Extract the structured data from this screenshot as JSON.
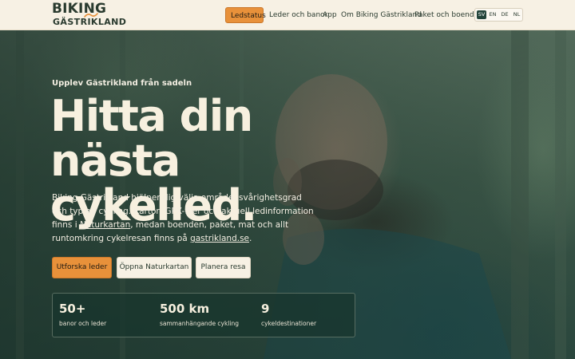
{
  "brand": {
    "logo_top": "BIKING",
    "logo_bottom": "GÄSTRIKLAND",
    "accent": "#e8913a",
    "dark": "#22443a"
  },
  "nav": {
    "items": [
      {
        "label": "Ledstatus",
        "active": true
      },
      {
        "label": "Leder och banor"
      },
      {
        "label": "App"
      },
      {
        "label": "Om Biking Gästrikland"
      },
      {
        "label": "Paket och boende"
      }
    ],
    "languages": [
      {
        "code": "SV",
        "active": true
      },
      {
        "code": "EN"
      },
      {
        "code": "DE"
      },
      {
        "code": "NL"
      }
    ]
  },
  "hero": {
    "eyebrow": "Upplev Gästrikland från sadeln",
    "headline_line1": "Hitta din nästa",
    "headline_line2": "cykelled.",
    "intro_before_link1": "Biking Gästrikland hjälper dig välja område, svårighetsgrad och typ av cykling. Kartor, GPX-filer och aktuell ledinformation finns i ",
    "intro_link1": "Naturkartan",
    "intro_between": ", medan boenden, paket, mat och allt runtomkring cykelresan finns på ",
    "intro_link2": "gastrikland.se",
    "intro_after": ".",
    "buttons": {
      "primary": "Utforska leder",
      "secondary1": "Öppna Naturkartan",
      "secondary2": "Planera resa"
    },
    "stats": [
      {
        "value": "50+",
        "label": "banor och leder"
      },
      {
        "value": "500 km",
        "label": "sammanhängande cykling"
      },
      {
        "value": "9",
        "label": "cykeldestinationer"
      }
    ]
  }
}
